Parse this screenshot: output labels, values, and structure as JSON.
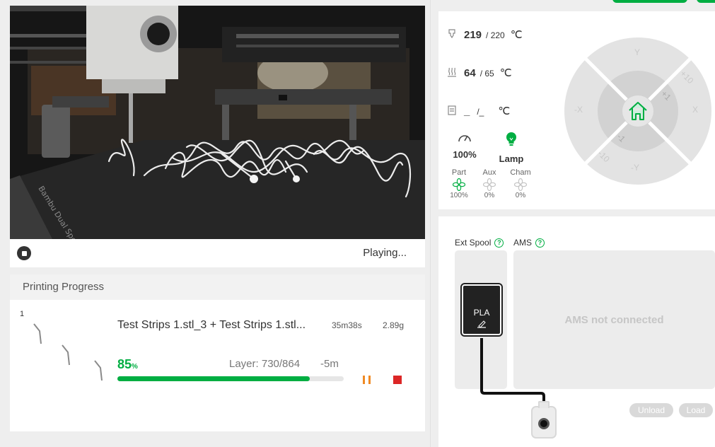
{
  "video": {
    "status": "Playing..."
  },
  "progress": {
    "title": "Printing Progress",
    "plate_number": "1",
    "file_name": "Test Strips 1.stl_3 + Test Strips 1.stl...",
    "time": "35m38s",
    "weight": "2.89g",
    "percent": "85",
    "percent_unit": "%",
    "percent_fraction": 0.85,
    "layer": "Layer: 730/864",
    "remaining": "-5m"
  },
  "temps": {
    "nozzle": {
      "current": "219",
      "target": "/ 220",
      "unit": "℃"
    },
    "bed": {
      "current": "64",
      "target": "/ 65",
      "unit": "℃"
    },
    "chamber": {
      "current": "_",
      "target": "/_",
      "unit": "℃"
    }
  },
  "speed": {
    "value": "100%"
  },
  "lamp": {
    "label": "Lamp"
  },
  "fans": [
    {
      "label": "Part",
      "value": "100%"
    },
    {
      "label": "Aux",
      "value": "0%"
    },
    {
      "label": "Cham",
      "value": "0%"
    }
  ],
  "jog": {
    "y_plus": "Y",
    "y_minus": "-Y",
    "x_plus": "X",
    "x_minus": "-X",
    "step_plus_10": "+10",
    "step_plus_1": "+1",
    "step_minus_1": "-1",
    "step_minus_10": "-10"
  },
  "ams": {
    "ext_spool_label": "Ext Spool",
    "ams_label": "AMS",
    "help": "?",
    "not_connected": "AMS not connected",
    "spool_material": "PLA",
    "unload": "Unload",
    "load": "Load"
  },
  "colors": {
    "accent": "#00ae42",
    "pause": "#f08a24",
    "stop": "#dc2626",
    "lamp": "#00ae42"
  }
}
